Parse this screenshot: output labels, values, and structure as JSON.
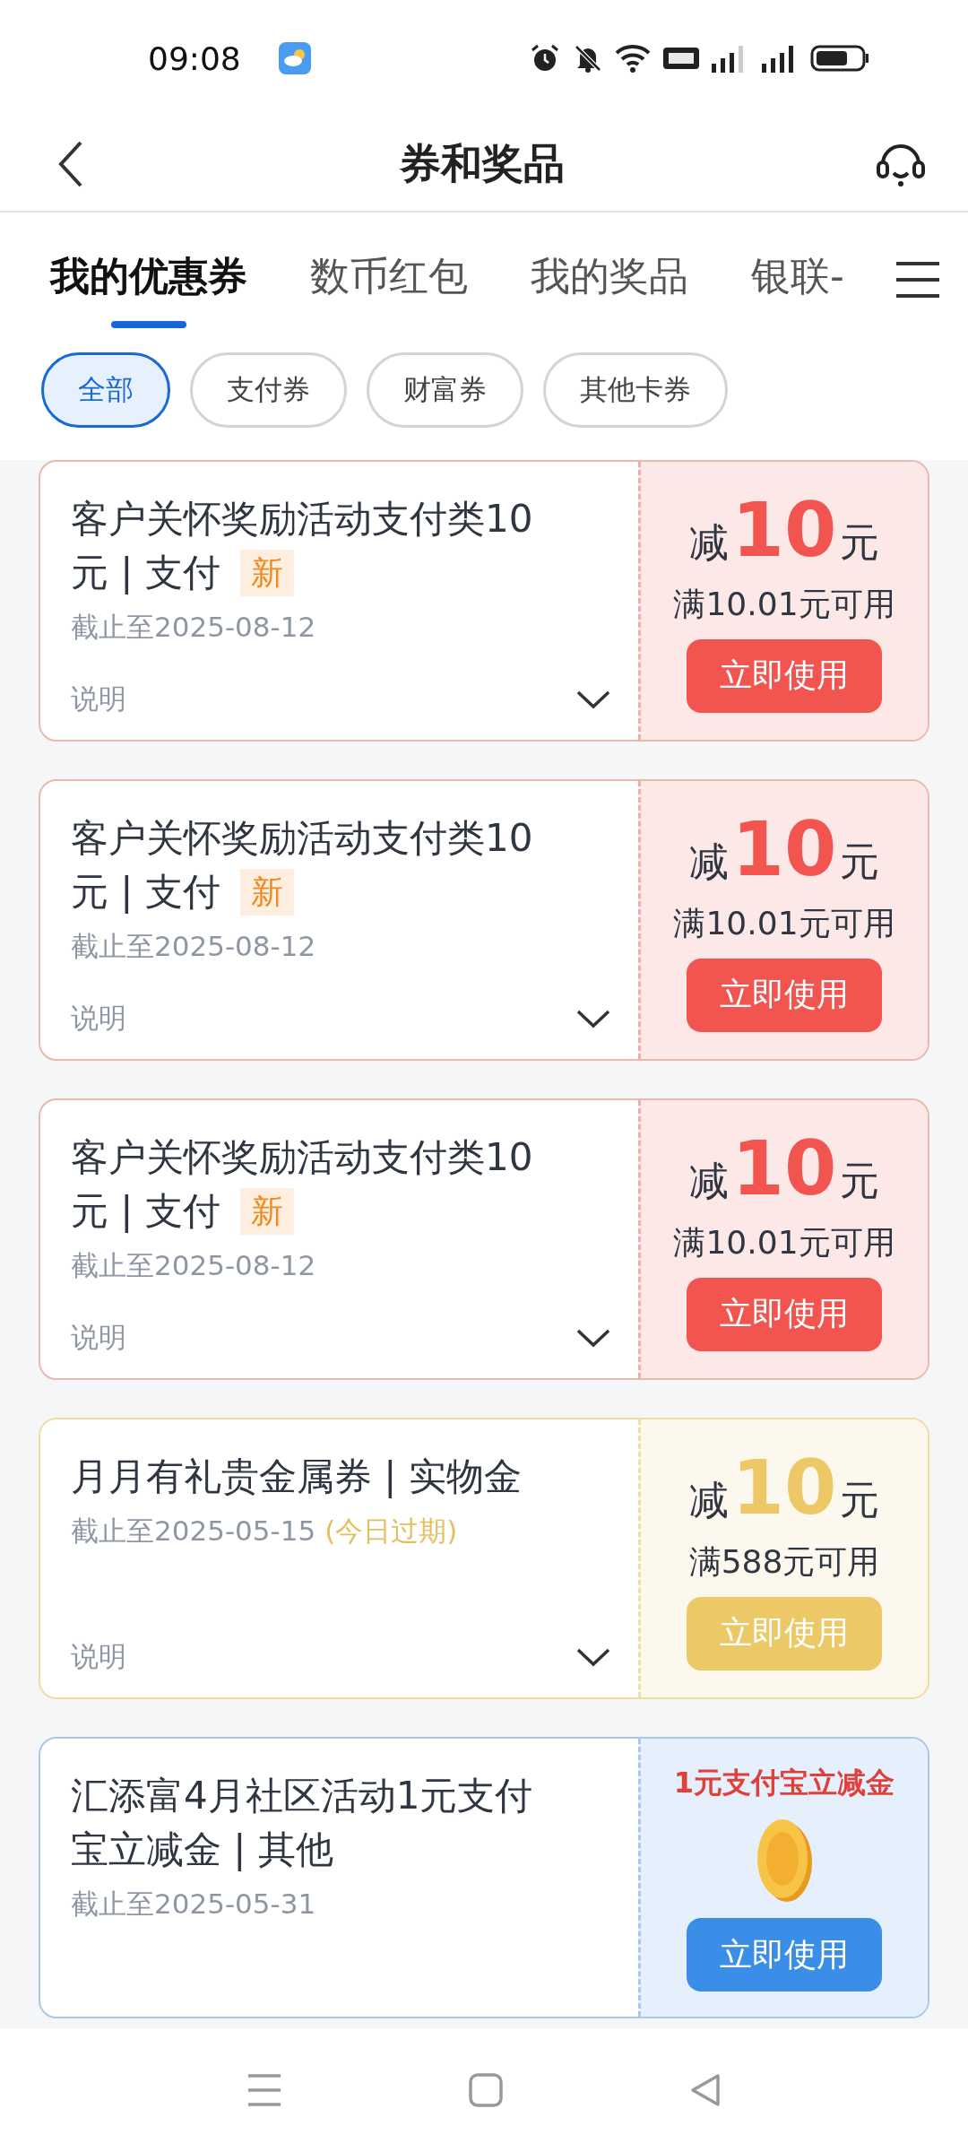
{
  "status_bar": {
    "time": "09:08"
  },
  "header": {
    "title": "券和奖品"
  },
  "tabs": [
    {
      "label": "我的优惠券",
      "selected": true
    },
    {
      "label": "数币红包",
      "selected": false
    },
    {
      "label": "我的奖品",
      "selected": false
    },
    {
      "label": "银联-",
      "selected": false
    }
  ],
  "filters": [
    {
      "label": "全部",
      "selected": true
    },
    {
      "label": "支付券",
      "selected": false
    },
    {
      "label": "财富券",
      "selected": false
    },
    {
      "label": "其他卡券",
      "selected": false
    }
  ],
  "coupons": [
    {
      "kind": "red",
      "title_lines": [
        "客户关怀奖励活动支付类10",
        "元 | 支付"
      ],
      "new_label": "新",
      "deadline": "截止至2025-08-12",
      "details_label": "说明",
      "prefix": "减",
      "amount": "10",
      "unit": "元",
      "condition": "满10.01元可用",
      "button": "立即使用"
    },
    {
      "kind": "red",
      "title_lines": [
        "客户关怀奖励活动支付类10",
        "元 | 支付"
      ],
      "new_label": "新",
      "deadline": "截止至2025-08-12",
      "details_label": "说明",
      "prefix": "减",
      "amount": "10",
      "unit": "元",
      "condition": "满10.01元可用",
      "button": "立即使用"
    },
    {
      "kind": "red",
      "title_lines": [
        "客户关怀奖励活动支付类10",
        "元 | 支付"
      ],
      "new_label": "新",
      "deadline": "截止至2025-08-12",
      "details_label": "说明",
      "prefix": "减",
      "amount": "10",
      "unit": "元",
      "condition": "满10.01元可用",
      "button": "立即使用"
    },
    {
      "kind": "gold",
      "title_lines": [
        "月月有礼贵金属券 | 实物金"
      ],
      "deadline": "截止至2025-05-15",
      "expiry_note": "(今日过期)",
      "details_label": "说明",
      "prefix": "减",
      "amount": "10",
      "unit": "元",
      "condition": "满588元可用",
      "button": "立即使用"
    },
    {
      "kind": "promo",
      "title_lines": [
        "汇添富4月社区活动1元支付",
        "宝立减金 | 其他"
      ],
      "deadline": "截止至2025-05-31",
      "promo_text": "1元支付宝立减金",
      "button": "立即使用"
    }
  ]
}
